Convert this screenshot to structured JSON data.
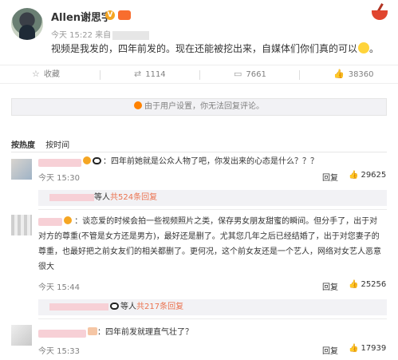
{
  "post": {
    "author": "Allen谢思宇",
    "verified_mark": "V",
    "time": "今天 15:22 来自",
    "text": "视频是我发的，四年前发的。现在还能被挖出来，自媒体们你们真的可以"
  },
  "actions": {
    "favorite": "收藏",
    "repost": "1114",
    "comment": "7661",
    "like": "38360"
  },
  "notice": "由于用户设置，你无法回复评论。",
  "sort": {
    "hot": "按热度",
    "time": "按时间"
  },
  "comments": [
    {
      "text": "：四年前她就是公众人物了吧，你发出来的心态是什么？？？",
      "time": "今天 15:30",
      "reply": "回复",
      "likes": "29625",
      "sub_prefix": "等人",
      "sub_more": "共524条回复"
    },
    {
      "lines": [
        "：谈恋爱的时候会拍一些视频照片之类，保存男女朋友甜蜜的瞬间。但分手了，出于对",
        "对方的尊重(不管是女方还是男方)，最好还是删了。尤其您几年之后已经结婚了，出于对您妻子的",
        "尊重，也最好把之前女友们的相关都删了。更何况，这个前女友还是一个艺人，网络对女艺人恶意",
        "很大"
      ],
      "time": "今天 15:44",
      "reply": "回复",
      "likes": "25256",
      "sub_prefix": "等人",
      "sub_more": "共217条回复"
    },
    {
      "text": "：四年前发就理直气壮了？",
      "time": "今天 15:33",
      "reply": "回复",
      "likes": "17939"
    }
  ],
  "icons": {
    "favorite": "star-icon",
    "repost": "repost-icon",
    "comment": "comment-icon",
    "like": "thumbs-up-icon",
    "notice": "lock-icon",
    "logo": "weibo-logo-icon"
  },
  "colors": {
    "accent": "#eb7350",
    "notice_bg": "#f2f2f5",
    "muted": "#808080"
  }
}
